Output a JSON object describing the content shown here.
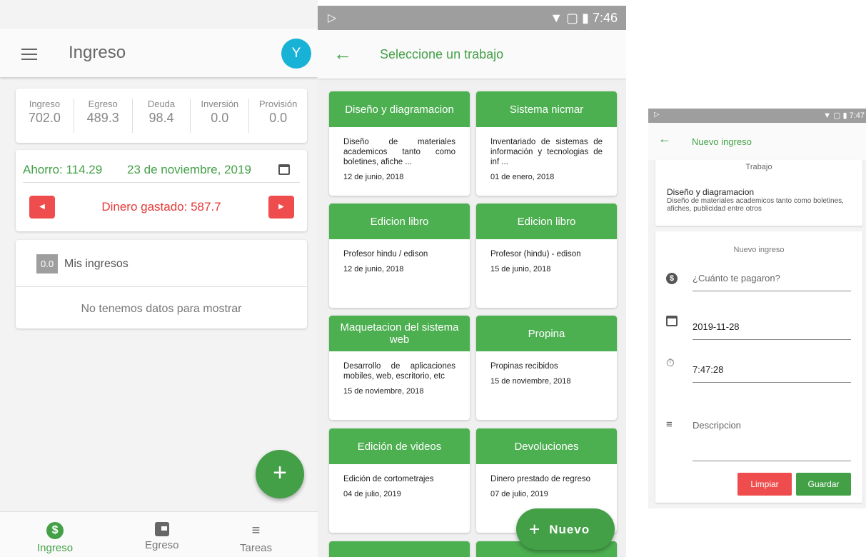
{
  "screen1": {
    "title": "Ingreso",
    "avatar": "Y",
    "stats": [
      {
        "label": "Ingreso",
        "value": "702.0"
      },
      {
        "label": "Egreso",
        "value": "489.3"
      },
      {
        "label": "Deuda",
        "value": "98.4"
      },
      {
        "label": "Inversión",
        "value": "0.0"
      },
      {
        "label": "Provisión",
        "value": "0.0"
      }
    ],
    "ahorro": "Ahorro: 114.29",
    "date": "23 de noviembre, 2019",
    "gastado": "Dinero gastado: 587.7",
    "mis_badge": "0.0",
    "mis_label": "Mis ingresos",
    "no_data": "No tenemos datos para mostrar",
    "fab": "+",
    "nav": [
      {
        "label": "Ingreso",
        "icon": "dollar-icon"
      },
      {
        "label": "Egreso",
        "icon": "wallet-icon"
      },
      {
        "label": "Tareas",
        "icon": "list-icon"
      }
    ]
  },
  "screen2": {
    "status_time": "7:46",
    "title": "Seleccione un trabajo",
    "jobs": [
      {
        "title": "Diseño y diagramacion",
        "desc": "Diseño de materiales academicos tanto como boletines, afiche ...",
        "date": "12 de junio, 2018"
      },
      {
        "title": "Sistema nicmar",
        "desc": "Inventariado de sistemas de información y tecnologias de inf ...",
        "date": "01 de enero, 2018"
      },
      {
        "title": "Edicion libro",
        "desc": "Profesor hindu / edison",
        "date": "12 de junio, 2018"
      },
      {
        "title": "Edicion libro",
        "desc": "Profesor (hindu) - edison",
        "date": "15 de junio, 2018"
      },
      {
        "title": "Maquetacion del sistema web",
        "desc": "Desarrollo de aplicaciones mobiles, web, escritorio, etc",
        "date": "15 de noviembre, 2018"
      },
      {
        "title": "Propina",
        "desc": "Propinas recibidos",
        "date": "15 de noviembre, 2018"
      },
      {
        "title": "Edición de videos",
        "desc": "Edición de cortometrajes",
        "date": "04 de julio, 2019"
      },
      {
        "title": "Devoluciones",
        "desc": "Dinero prestado de regreso",
        "date": "07 de julio, 2019"
      }
    ],
    "nuevo": "Nuevo"
  },
  "screen3": {
    "status_time": "7:47",
    "title": "Nuevo ingreso",
    "trabajo_label": "Trabajo",
    "trabajo_name": "Diseño y diagramacion",
    "trabajo_desc": "Diseño de materiales academicos tanto como boletines, afiches, publicidad entre otros",
    "form_title": "Nuevo ingreso",
    "amount_placeholder": "¿Cuánto te pagaron?",
    "date_value": "2019-11-28",
    "time_value": "7:47:28",
    "desc_placeholder": "Descripcion",
    "clear": "Limpiar",
    "save": "Guardar",
    "colors": {
      "green": "#43a047",
      "red": "#ef4d4d"
    }
  }
}
